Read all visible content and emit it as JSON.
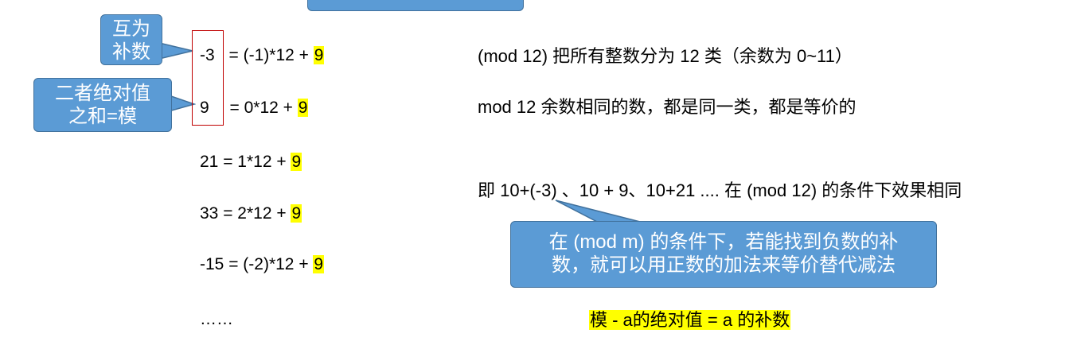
{
  "callouts": {
    "complement": "互为\n补数",
    "abs_sum": "二者绝对值\n之和=模",
    "neg_complement": "在 (mod m) 的条件下，若能找到负数的补\n数，就可以用正数的加法来等价替代减法"
  },
  "equations": [
    {
      "lhs": "-3",
      "rhs": " = (-1)*12 + ",
      "rem": "9"
    },
    {
      "lhs": "9",
      "rhs": " = 0*12 + ",
      "rem": "9"
    },
    {
      "lhs": "21",
      "rhs": " = 1*12 + ",
      "rem": "9"
    },
    {
      "lhs": "33",
      "rhs": " = 2*12 + ",
      "rem": "9"
    },
    {
      "lhs": "-15",
      "rhs": " = (-2)*12 + ",
      "rem": "9"
    }
  ],
  "ellipsis": "……",
  "notes": {
    "classes": "(mod 12) 把所有整数分为 12 类（余数为 0~11）",
    "equivalent": "mod 12 余数相同的数，都是同一类，都是等价的",
    "example": "即 10+(-3) 、10 + 9、10+21 .... 在 (mod 12) 的条件下效果相同",
    "formula": "模 - a的绝对值 = a 的补数"
  },
  "colors": {
    "callout_fill": "#5b9bd5",
    "highlight": "#ffff00",
    "box_border": "#c00000"
  }
}
